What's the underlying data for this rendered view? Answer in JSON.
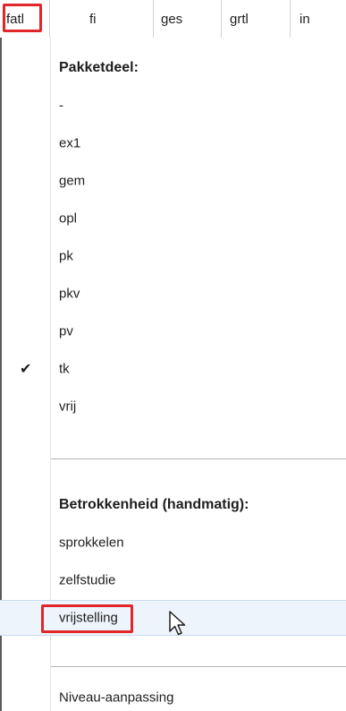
{
  "header": {
    "columns": [
      "fatl",
      "fi",
      "ges",
      "grtl",
      "in"
    ]
  },
  "menu": {
    "section1_heading": "Pakketdeel:",
    "pakketdeel_items": [
      "-",
      "ex1",
      "gem",
      "opl",
      "pk",
      "pkv",
      "pv",
      "tk",
      "vrij"
    ],
    "checked_item": "tk",
    "section2_heading": "Betrokkenheid (handmatig):",
    "betrokkenheid_items": [
      "sprokkelen",
      "zelfstudie",
      "vrijstelling"
    ],
    "hovered_item": "vrijstelling",
    "last_item": "Niveau-aanpassing"
  },
  "icons": {
    "check": "checkmark-icon",
    "pointer": "mouse-pointer-icon"
  },
  "colors": {
    "highlight_border": "#e0252b",
    "hover_background": "#eef4fc"
  }
}
